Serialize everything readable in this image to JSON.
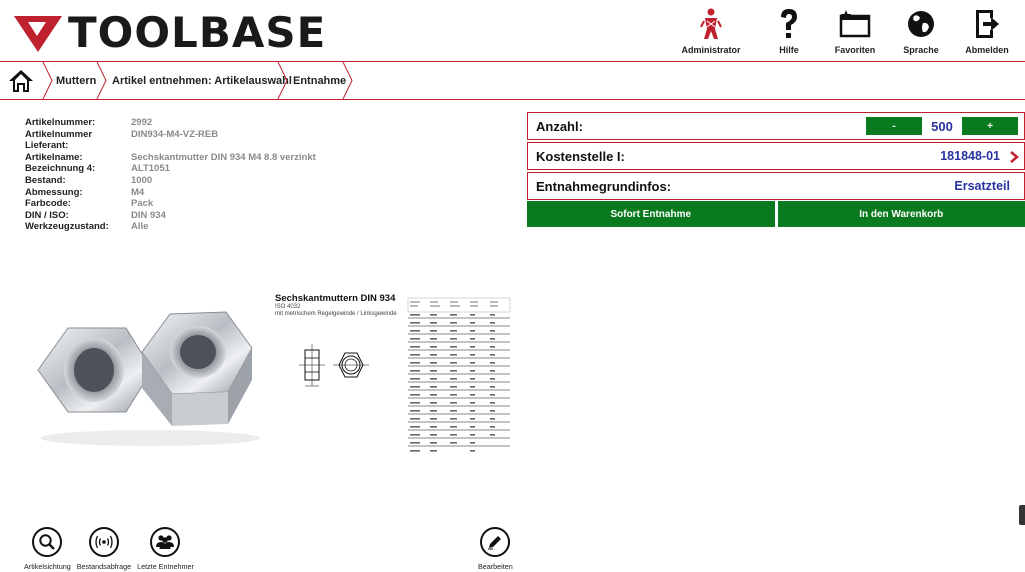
{
  "brand": {
    "logo_text": "TOOLBASE",
    "accent": "#c0212e",
    "green": "#0a7a1e",
    "value_blue": "#2832a0"
  },
  "top_actions": [
    {
      "label": "Administrator",
      "icon": "administrator-figure-icon"
    },
    {
      "label": "Hilfe",
      "icon": "question-mark-icon"
    },
    {
      "label": "Favoriten",
      "icon": "favorites-folder-star-icon"
    },
    {
      "label": "Sprache",
      "icon": "globe-icon"
    },
    {
      "label": "Abmelden",
      "icon": "logout-arrow-icon"
    }
  ],
  "breadcrumb": [
    {
      "label": "Muttern"
    },
    {
      "label": "Artikel entnehmen: Artikelauswahl"
    },
    {
      "label": "Entnahme"
    }
  ],
  "article": {
    "rows": [
      {
        "key": "Artikelnummer:",
        "value": "2992"
      },
      {
        "key": "Artikelnummer Lieferant:",
        "value": "DIN934-M4-VZ-REB"
      },
      {
        "key": "Artikelname:",
        "value": "Sechskantmutter DIN 934 M4 8.8 verzinkt"
      },
      {
        "key": "Bezeichnung 4:",
        "value": "ALT1051"
      },
      {
        "key": "Bestand:",
        "value": "1000"
      },
      {
        "key": "Abmessung:",
        "value": "M4"
      },
      {
        "key": "Farbcode:",
        "value": "Pack"
      },
      {
        "key": "DIN / ISO:",
        "value": "DIN 934"
      },
      {
        "key": "Werkzeugzustand:",
        "value": "Alle"
      }
    ]
  },
  "panel": {
    "anzahl_label": "Anzahl:",
    "minus": "-",
    "plus": "+",
    "anzahl_value": "500",
    "kostenstelle_label": "Kostenstelle I:",
    "kostenstelle_value": "181848-01",
    "grund_label": "Entnahmegrundinfos:",
    "grund_value": "Ersatzteil"
  },
  "buttons": {
    "sofort": "Sofort Entnahme",
    "warenkorb": "In den Warenkorb"
  },
  "spec": {
    "title": "Sechskantmuttern DIN 934",
    "iso": "ISO 4032",
    "note": "mit metrischem Regelgewinde / Linksgewinde"
  },
  "bottom_tools": [
    {
      "label": "Artikelsichtung",
      "icon": "search-icon"
    },
    {
      "label": "Bestandsabfrage",
      "icon": "radio-signal-icon"
    },
    {
      "label": "Letzte Entnehmer",
      "icon": "users-group-icon"
    }
  ],
  "edit_tool": {
    "label": "Bearbeiten",
    "icon": "pencil-icon"
  }
}
